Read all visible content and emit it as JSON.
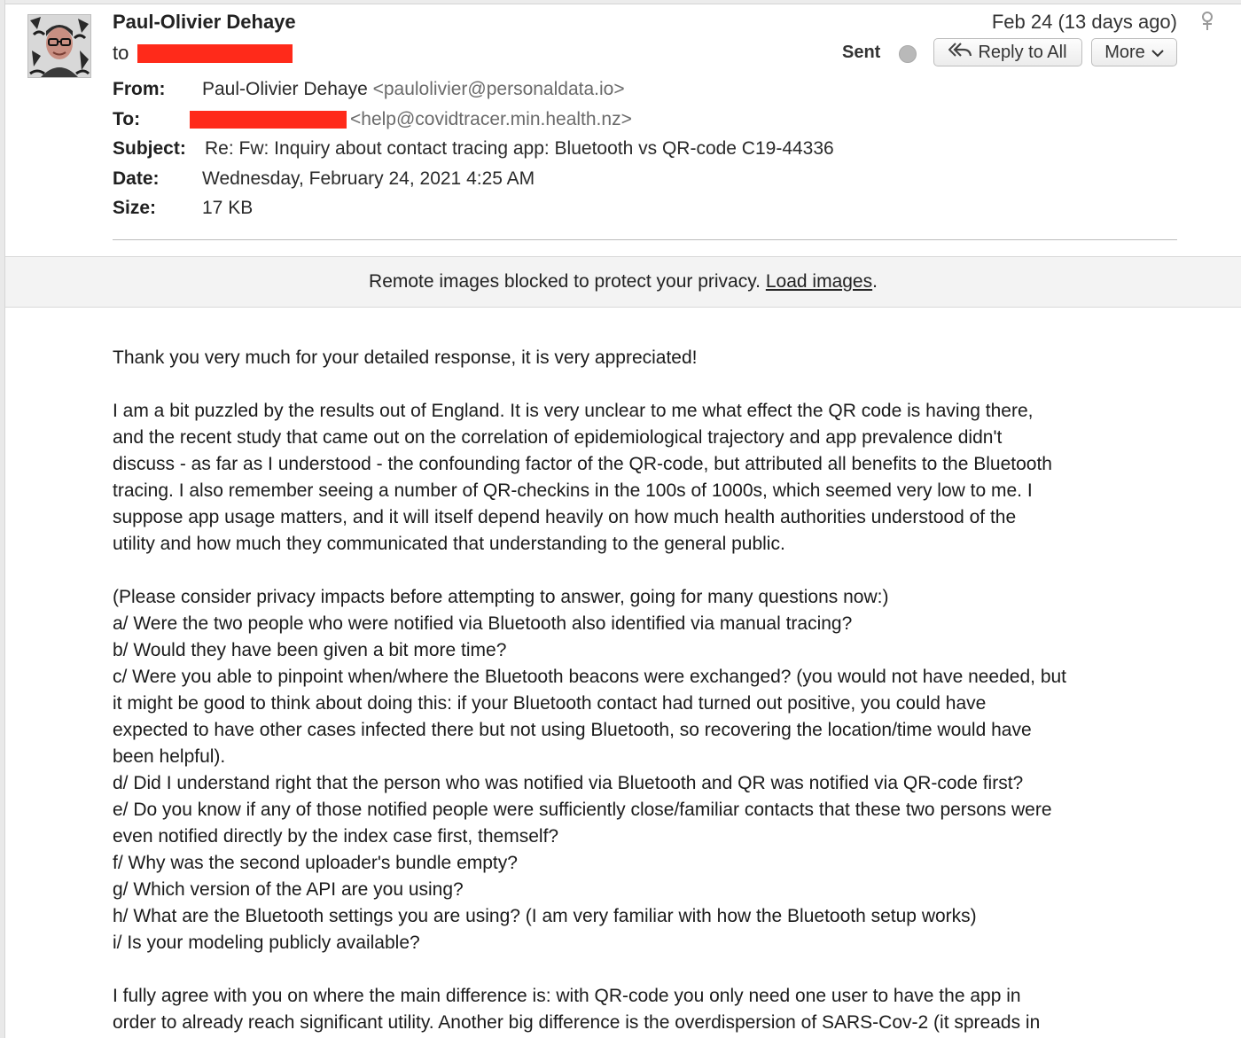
{
  "header": {
    "sender_name": "Paul-Olivier Dehaye",
    "to_label": "to",
    "date_short": "Feb 24 (13 days ago)",
    "status": "Sent",
    "reply_all_label": "Reply to All",
    "more_label": "More"
  },
  "details": {
    "from_label": "From:",
    "from_name": "Paul-Olivier Dehaye",
    "from_address": "<paulolivier@personaldata.io>",
    "to_label": "To:",
    "to_address": "<help@covidtracer.min.health.nz>",
    "subject_label": "Subject:",
    "subject": "Re: Fw: Inquiry about contact tracing app: Bluetooth vs QR-code C19-44336",
    "date_label": "Date:",
    "date": "Wednesday, February 24, 2021 4:25 AM",
    "size_label": "Size:",
    "size": "17 KB"
  },
  "banner": {
    "text": "Remote images blocked to protect your privacy.",
    "link": "Load images",
    "suffix": "."
  },
  "body": {
    "p1": "Thank you very much for your detailed response, it is very appreciated!",
    "p2": "I am a bit puzzled by the results out of England. It is very unclear to me what effect the QR code is having there,\nand the recent study that came out on the correlation of epidemiological trajectory and app prevalence didn't\ndiscuss - as far as I understood - the confounding factor of the QR-code, but attributed all benefits to the Bluetooth\ntracing. I also remember seeing a number of QR-checkins in the 100s of 1000s, which seemed very low to me. I\nsuppose app usage matters, and it will itself depend heavily on how much health authorities understood of the\nutility and how much they communicated that understanding to the general public.",
    "p3": "(Please consider privacy impacts before attempting to answer, going for many questions now:)\na/ Were the two people who were notified via Bluetooth also identified via manual tracing?\nb/ Would they have been given a bit more time?\nc/ Were you able to pinpoint when/where the Bluetooth beacons were exchanged? (you would not have needed, but\nit might be good to think about doing this: if your Bluetooth contact had turned out positive, you could have\nexpected to have other cases infected there but not using Bluetooth, so recovering the location/time would have\nbeen helpful).\nd/ Did I understand right that the person who was notified via Bluetooth and QR was notified via QR-code first?\ne/ Do you know if any of those notified people were sufficiently close/familiar contacts that these two persons were\neven notified directly by the index case first, themself?\nf/ Why was the second uploader's bundle empty?\ng/ Which version of the API are you using?\nh/ What are the Bluetooth settings you are using? (I am very familiar with how the Bluetooth setup works)\ni/ Is your modeling publicly available?",
    "p4": "I fully agree with you on where the main difference is: with QR-code you only need one user to have the app in\norder to already reach significant utility. Another big difference is the overdispersion of SARS-Cov-2 (it spreads in"
  },
  "icons": {
    "avatar": "sender-avatar",
    "reply_all": "reply-all-icon",
    "more": "chevron-down-icon",
    "pin": "pin-icon",
    "status": "status-dot-icon"
  },
  "colors": {
    "redaction": "#ff2a1a",
    "banner_bg": "#f3f3f3"
  }
}
